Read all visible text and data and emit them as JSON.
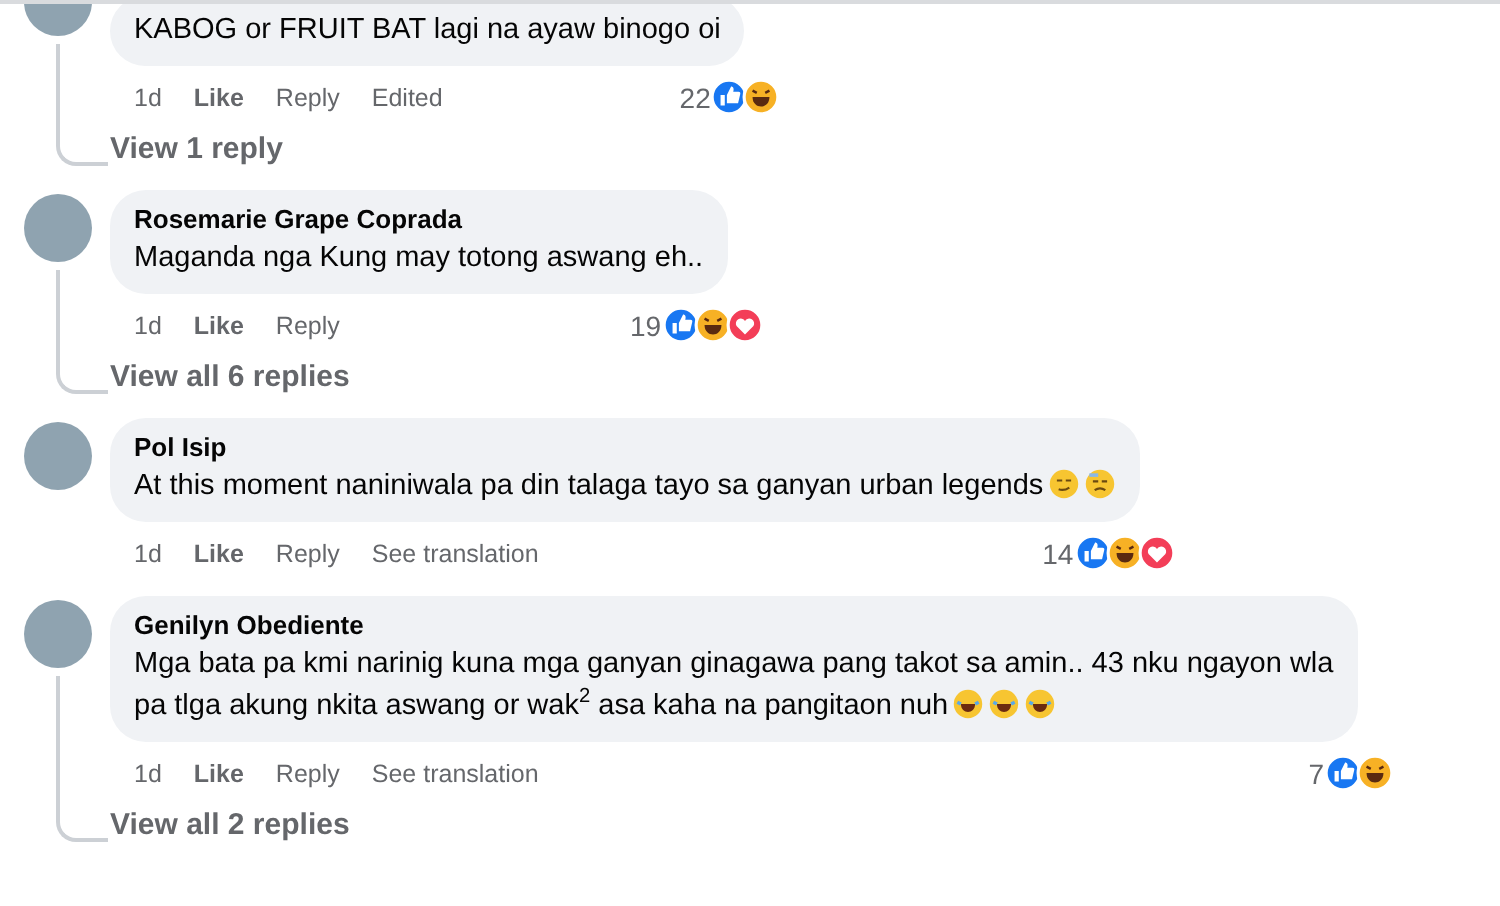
{
  "comments": [
    {
      "text": "KABOG or FRUIT BAT lagi na ayaw binogo oi",
      "time": "1d",
      "actions": [
        "Like",
        "Reply",
        "Edited"
      ],
      "reaction_count": "22",
      "reactions": [
        {
          "kind": "like"
        },
        {
          "kind": "haha"
        }
      ],
      "replies_link": "View 1 reply"
    },
    {
      "author": "Rosemarie Grape Coprada",
      "text": "Maganda nga Kung may totong aswang eh..",
      "time": "1d",
      "actions": [
        "Like",
        "Reply"
      ],
      "reaction_count": "19",
      "reactions": [
        {
          "kind": "like"
        },
        {
          "kind": "haha"
        },
        {
          "kind": "love"
        }
      ],
      "replies_link": "View all 6 replies"
    },
    {
      "author": "Pol Isip",
      "text": "At this moment naniniwala pa din talaga tayo sa ganyan urban legends",
      "emojis": [
        {
          "kind": "smirk"
        },
        {
          "kind": "sad"
        }
      ],
      "time": "1d",
      "actions": [
        "Like",
        "Reply",
        "See translation"
      ],
      "reaction_count": "14",
      "reactions": [
        {
          "kind": "like"
        },
        {
          "kind": "haha"
        },
        {
          "kind": "love"
        }
      ]
    },
    {
      "author": "Genilyn Obediente",
      "text": "Mga bata pa kmi narinig kuna mga ganyan ginagawa pang takot sa amin.. 43 nku ngayon wla pa tlga akung nkita aswang or wak$^{2}$ asa kaha na pangitaon nuh",
      "emojis": [
        {
          "kind": "joy"
        },
        {
          "kind": "joy"
        },
        {
          "kind": "joy"
        }
      ],
      "time": "1d",
      "actions": [
        "Like",
        "Reply",
        "See translation"
      ],
      "reaction_count": "7",
      "reactions": [
        {
          "kind": "like"
        },
        {
          "kind": "haha"
        }
      ],
      "replies_link": "View all 2 replies"
    }
  ]
}
